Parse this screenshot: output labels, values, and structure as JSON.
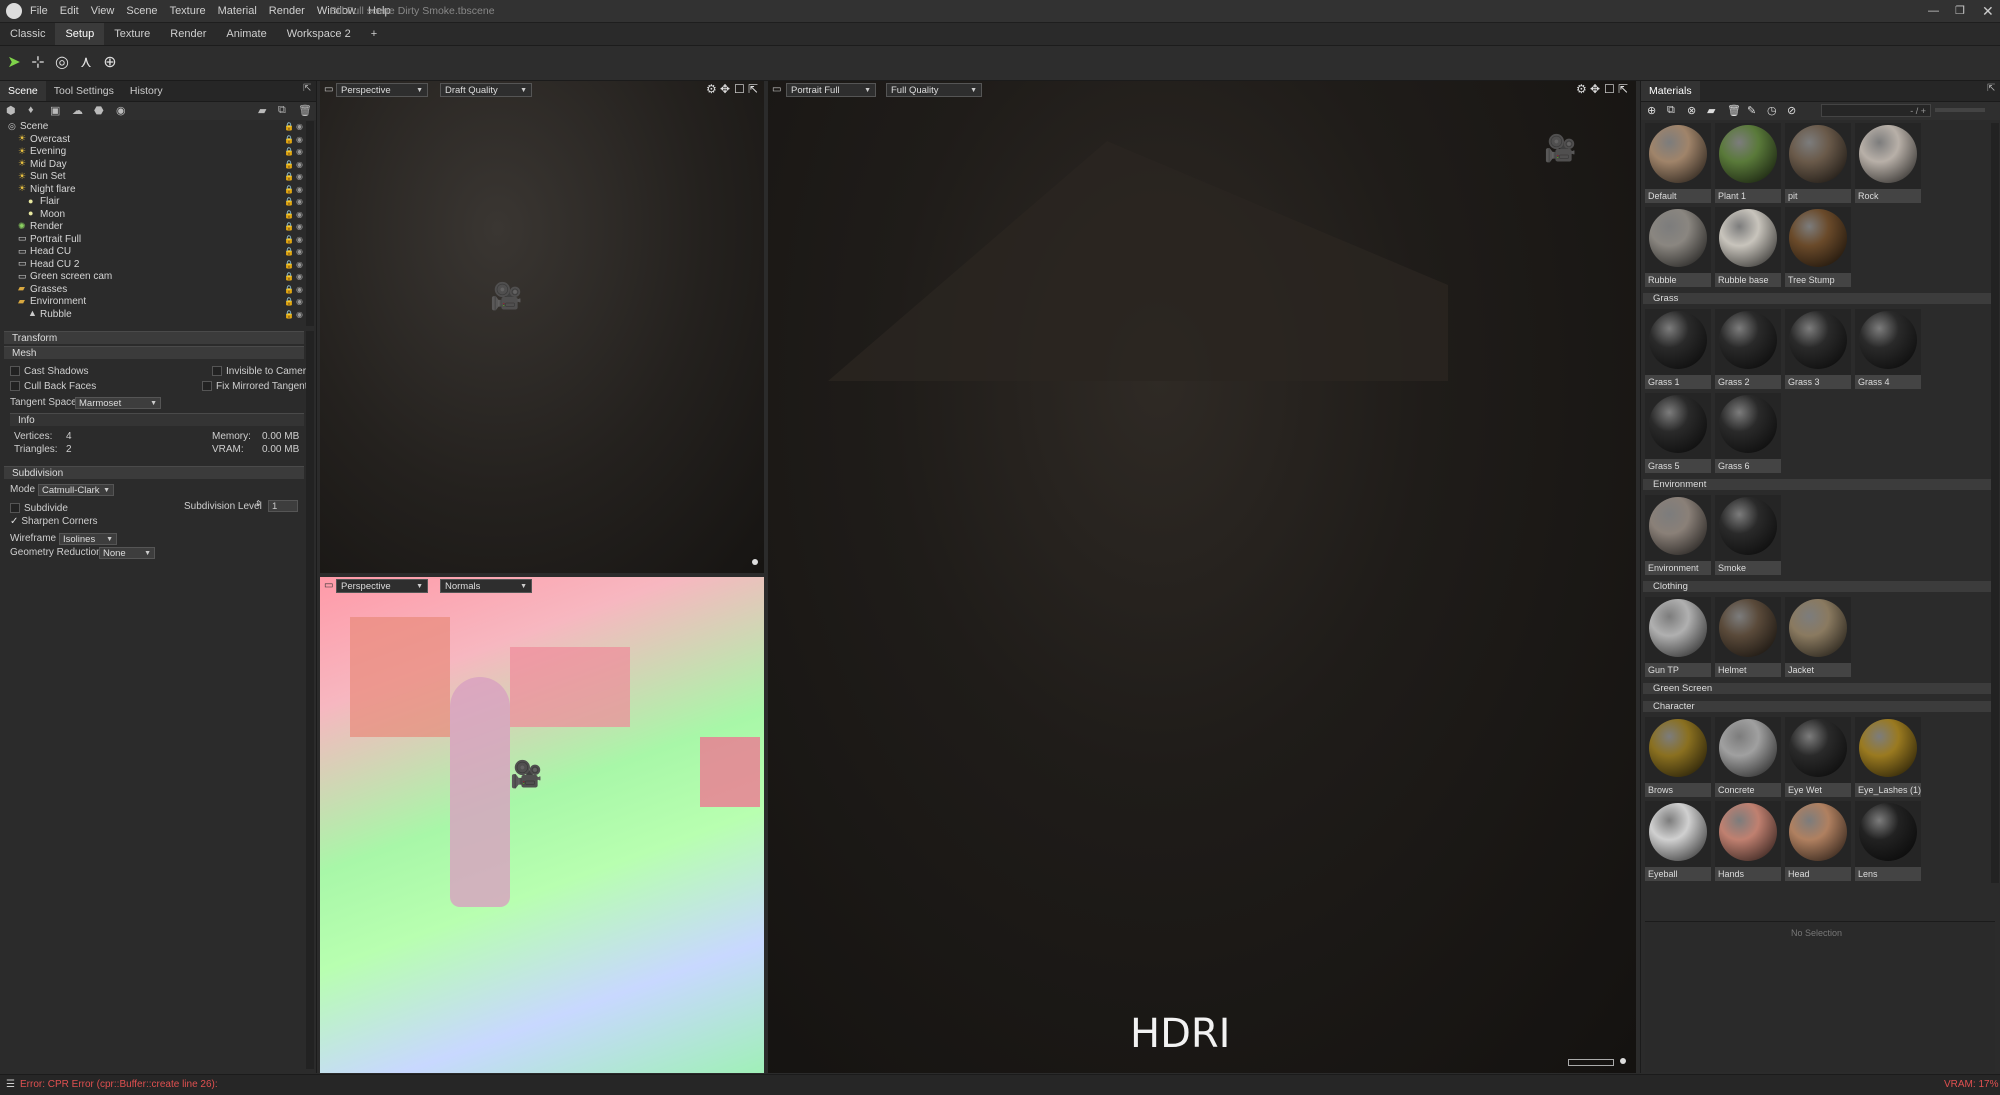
{
  "window": {
    "title": "Bill Full scene Dirty Smoke.tbscene",
    "menu": [
      "File",
      "Edit",
      "View",
      "Scene",
      "Texture",
      "Material",
      "Render",
      "Window",
      "Help"
    ]
  },
  "workspace_tabs": [
    "Classic",
    "Setup",
    "Texture",
    "Render",
    "Animate",
    "Workspace 2",
    "+"
  ],
  "left_panel": {
    "tabs": [
      "Scene",
      "Tool Settings",
      "History"
    ],
    "tree": [
      {
        "label": "Scene",
        "icon": "scene-icon",
        "depth": 0
      },
      {
        "label": "Overcast",
        "icon": "sun-icon",
        "depth": 1
      },
      {
        "label": "Evening",
        "icon": "sun-icon",
        "depth": 1
      },
      {
        "label": "Mid Day",
        "icon": "sun-icon",
        "depth": 1
      },
      {
        "label": "Sun Set",
        "icon": "sun-icon",
        "depth": 1
      },
      {
        "label": "Night flare",
        "icon": "sun-icon",
        "depth": 1
      },
      {
        "label": "Flair",
        "icon": "bulb-icon",
        "depth": 2
      },
      {
        "label": "Moon",
        "icon": "bulb-icon",
        "depth": 2
      },
      {
        "label": "Render",
        "icon": "render-icon",
        "depth": 1
      },
      {
        "label": "Portrait Full",
        "icon": "camera-icon",
        "depth": 1
      },
      {
        "label": "Head CU",
        "icon": "camera-icon",
        "depth": 1
      },
      {
        "label": "Head CU 2",
        "icon": "camera-icon",
        "depth": 1
      },
      {
        "label": "Green screen cam",
        "icon": "camera-icon",
        "depth": 1
      },
      {
        "label": "Grasses",
        "icon": "folder-icon",
        "depth": 1
      },
      {
        "label": "Environment",
        "icon": "folder-icon",
        "depth": 1
      },
      {
        "label": "Rubble",
        "icon": "mesh-icon",
        "depth": 2
      }
    ],
    "sections": {
      "transform": "Transform",
      "mesh": "Mesh",
      "info": "Info",
      "subdivision": "Subdivision"
    },
    "mesh": {
      "cast_shadows": "Cast Shadows",
      "invisible_to_camera": "Invisible to Camera",
      "cull_back_faces": "Cull Back Faces",
      "fix_mirrored_tangents": "Fix Mirrored Tangents",
      "tangent_space_label": "Tangent Space",
      "tangent_space_value": "Marmoset"
    },
    "info": {
      "vertices_label": "Vertices:",
      "vertices_value": "4",
      "triangles_label": "Triangles:",
      "triangles_value": "2",
      "memory_label": "Memory:",
      "memory_value": "0.00 MB",
      "vram_label": "VRAM:",
      "vram_value": "0.00 MB"
    },
    "subdivision": {
      "mode_label": "Mode",
      "mode_value": "Catmull-Clark",
      "subdivide": "Subdivide",
      "level_label": "Subdivision Level",
      "level_value": "1",
      "sharpen_corners": "Sharpen Corners",
      "wireframe_label": "Wireframe",
      "wireframe_value": "Isolines",
      "geo_reduction_label": "Geometry Reduction",
      "geo_reduction_value": "None"
    }
  },
  "viewports": {
    "top_left": {
      "camera": "Perspective",
      "quality": "Draft Quality"
    },
    "bottom_left": {
      "camera": "Perspective",
      "quality": "Normals"
    },
    "main": {
      "camera": "Portrait Full",
      "quality": "Full Quality",
      "overlay_text": "HDRI"
    }
  },
  "materials_panel": {
    "title": "Materials",
    "search_placeholder": "- / +",
    "groups": [
      {
        "name": "",
        "items": [
          {
            "label": "Default",
            "color": "#a0846a"
          },
          {
            "label": "Plant 1",
            "color": "#5a7a3a"
          },
          {
            "label": "pit",
            "color": "#6a5a4a"
          },
          {
            "label": "Rock",
            "color": "#b8b0a8"
          },
          {
            "label": "Rubble",
            "color": "#8a8680"
          },
          {
            "label": "Rubble base",
            "color": "#c8c4bc"
          },
          {
            "label": "Tree Stump",
            "color": "#6a4a2a"
          }
        ]
      },
      {
        "name": "Grass",
        "items": [
          {
            "label": "Grass 1",
            "color": "#2a2a2a"
          },
          {
            "label": "Grass 2",
            "color": "#2a2a2a"
          },
          {
            "label": "Grass 3",
            "color": "#2a2a2a"
          },
          {
            "label": "Grass 4",
            "color": "#2a2a2a"
          },
          {
            "label": "Grass 5",
            "color": "#2a2a2a"
          },
          {
            "label": "Grass 6",
            "color": "#2a2a2a"
          }
        ]
      },
      {
        "name": "Environment",
        "items": [
          {
            "label": "Environment",
            "color": "#8a8078"
          },
          {
            "label": "Smoke",
            "color": "#2a2a2a"
          }
        ]
      },
      {
        "name": "Clothing",
        "items": [
          {
            "label": "Gun TP",
            "color": "#b0b0b0"
          },
          {
            "label": "Helmet",
            "color": "#5a4a3a"
          },
          {
            "label": "Jacket",
            "color": "#8a7a60"
          }
        ]
      },
      {
        "name": "Green Screen",
        "items": []
      },
      {
        "name": "Character",
        "items": [
          {
            "label": "Brows",
            "color": "#8a7020"
          },
          {
            "label": "Concrete",
            "color": "#a0a0a0"
          },
          {
            "label": "Eye Wet",
            "color": "#2a2a2a"
          },
          {
            "label": "Eye_Lashes (1)",
            "color": "#9a7a20"
          },
          {
            "label": "Eyeball",
            "color": "#d0d0d0"
          },
          {
            "label": "Hands",
            "color": "#c08070"
          },
          {
            "label": "Head",
            "color": "#b08060"
          },
          {
            "label": "Lens",
            "color": "#222222"
          }
        ]
      }
    ],
    "no_selection": "No Selection"
  },
  "status": {
    "error": "Error: CPR Error (cpr::Buffer::create line 26):",
    "vram": "VRAM: 17%",
    "error_color": "#e05050"
  }
}
